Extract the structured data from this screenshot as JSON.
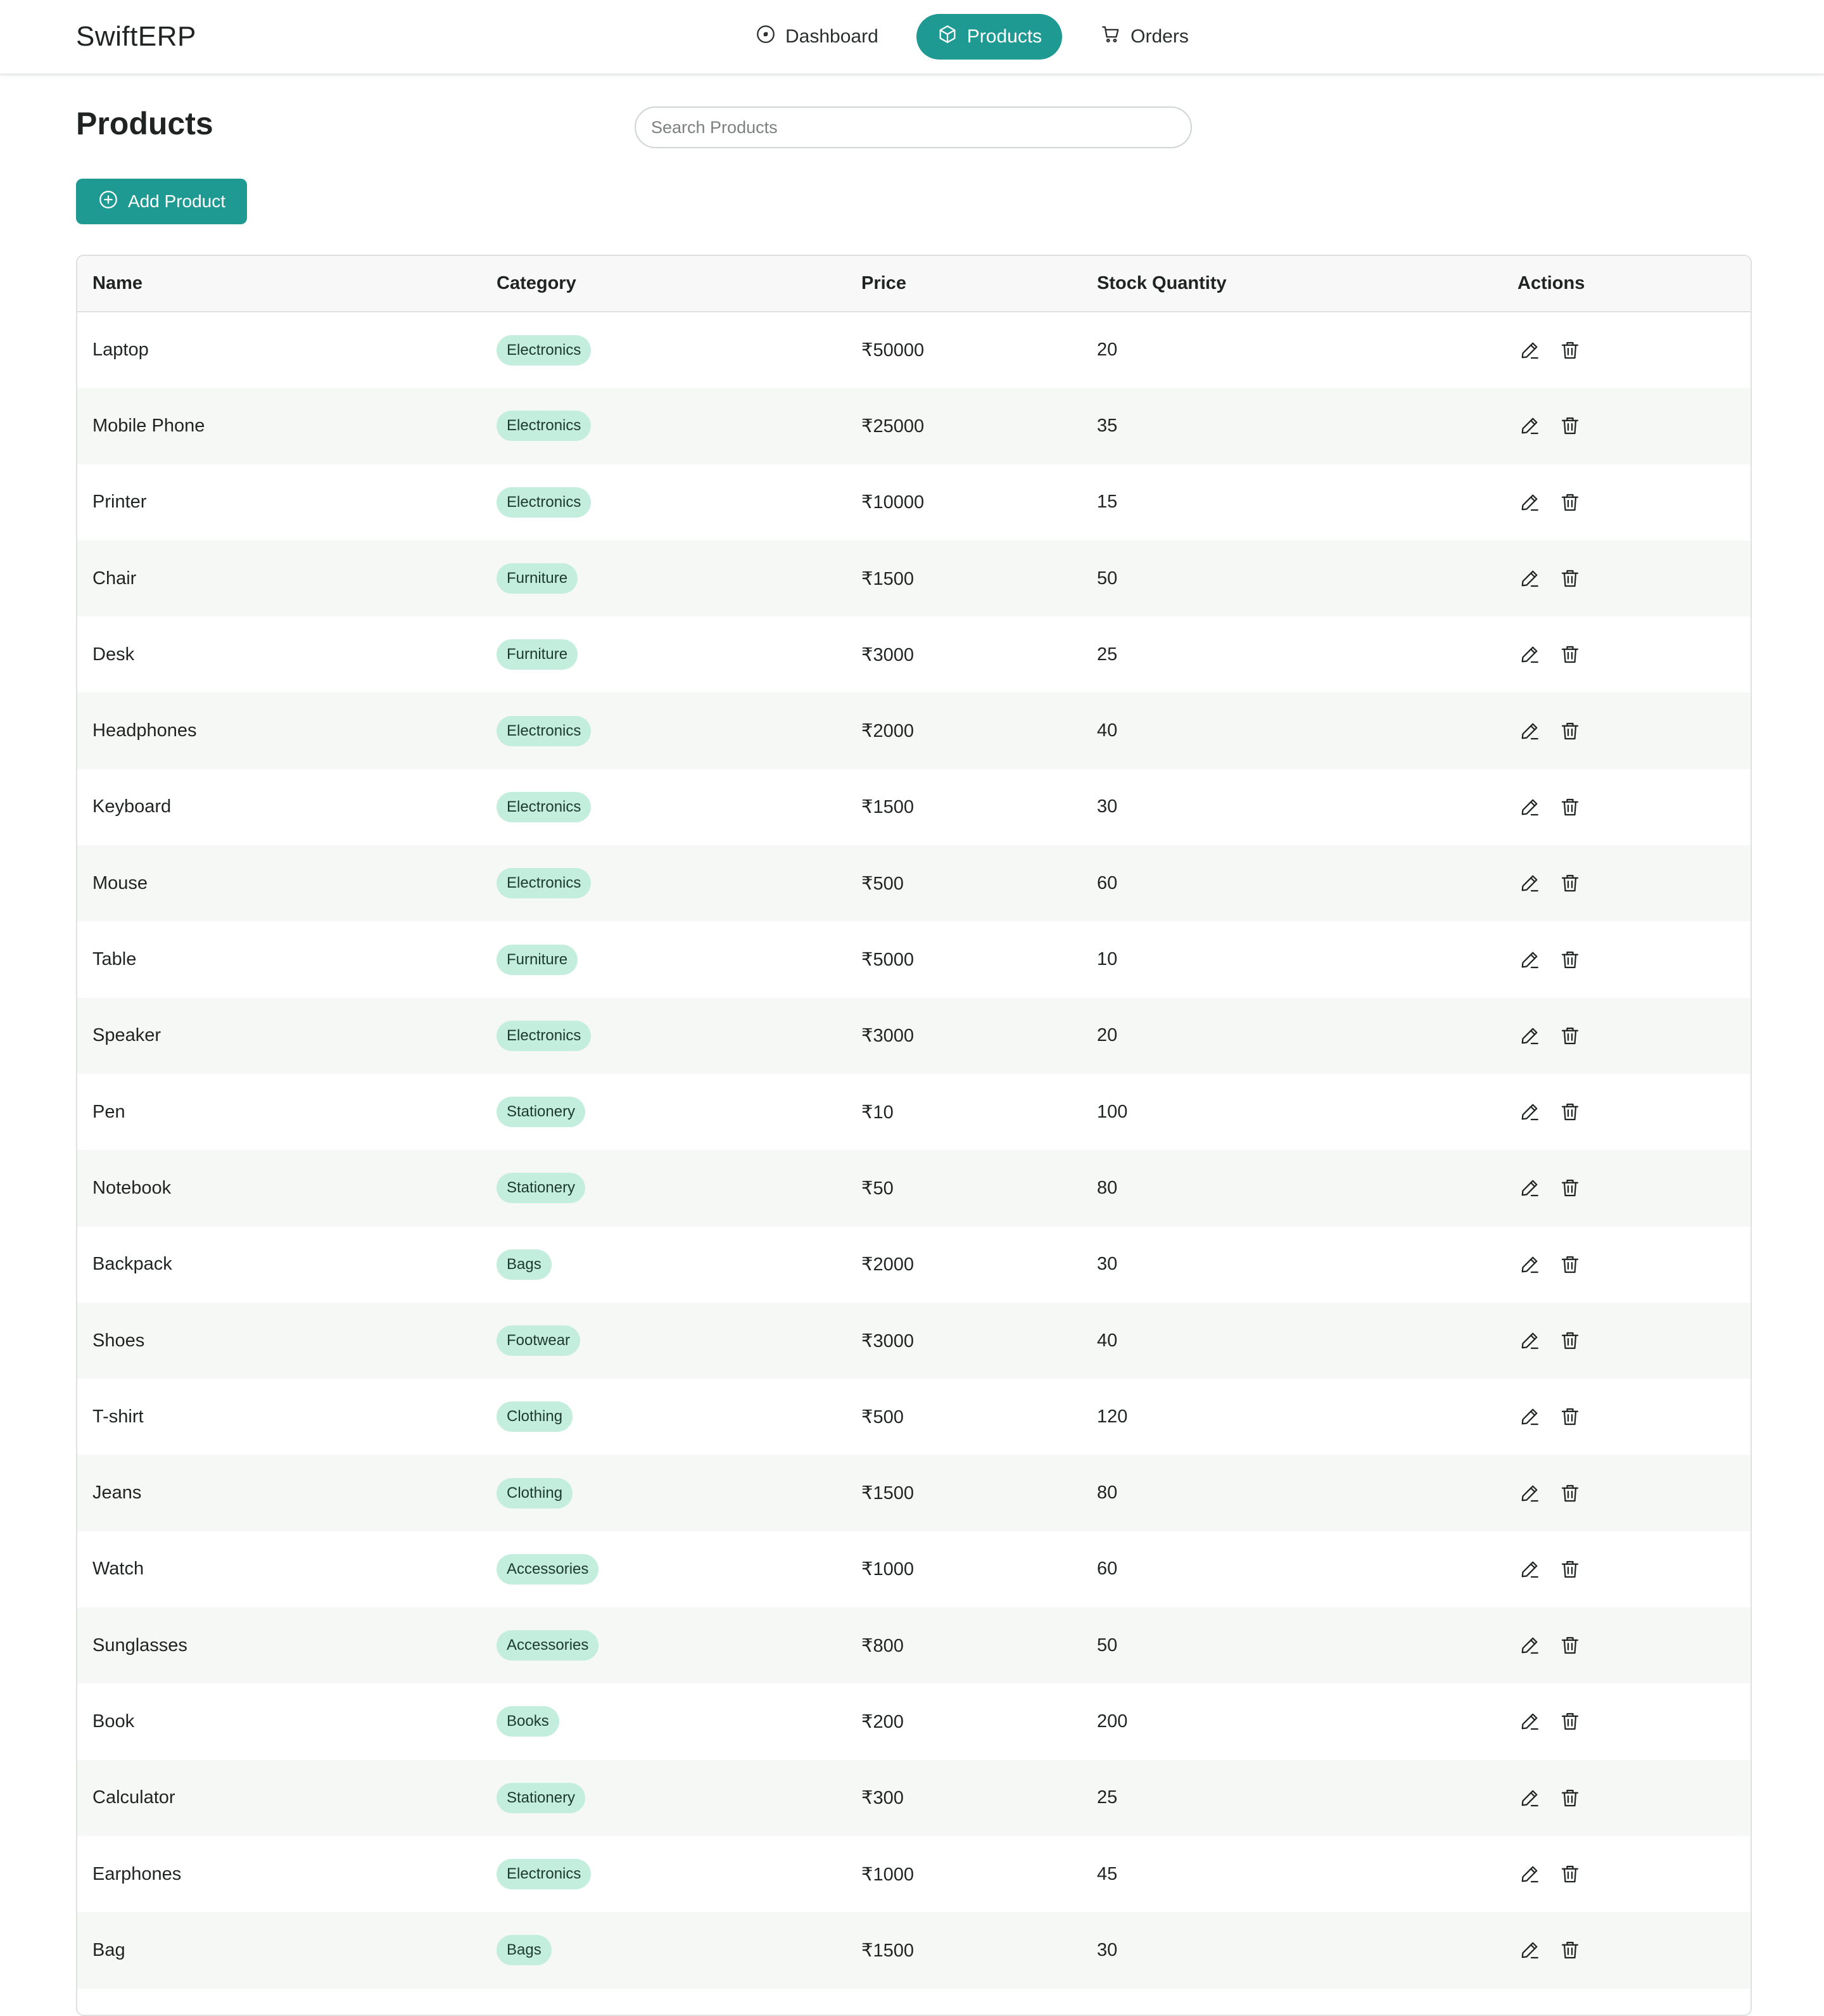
{
  "app": {
    "brand": "SwiftERP"
  },
  "nav": [
    {
      "label": "Dashboard",
      "icon": "gauge-icon",
      "active": false
    },
    {
      "label": "Products",
      "icon": "box-icon",
      "active": true
    },
    {
      "label": "Orders",
      "icon": "cart-icon",
      "active": false
    }
  ],
  "page": {
    "title": "Products"
  },
  "search": {
    "placeholder": "Search Products",
    "value": ""
  },
  "toolbar": {
    "add_label": "Add Product",
    "add_icon": "plus-circle-icon"
  },
  "colors": {
    "accent": "#1f9a93",
    "badge_bg": "#c3eedd",
    "row_alt": "#f6f8f6"
  },
  "table": {
    "columns": [
      "Name",
      "Category",
      "Price",
      "Stock Quantity",
      "Actions"
    ],
    "row_action_icons": [
      "edit-icon",
      "trash-icon"
    ],
    "rows": [
      {
        "name": "Laptop",
        "category": "Electronics",
        "price": "₹50000",
        "stock": "20"
      },
      {
        "name": "Mobile Phone",
        "category": "Electronics",
        "price": "₹25000",
        "stock": "35"
      },
      {
        "name": "Printer",
        "category": "Electronics",
        "price": "₹10000",
        "stock": "15"
      },
      {
        "name": "Chair",
        "category": "Furniture",
        "price": "₹1500",
        "stock": "50"
      },
      {
        "name": "Desk",
        "category": "Furniture",
        "price": "₹3000",
        "stock": "25"
      },
      {
        "name": "Headphones",
        "category": "Electronics",
        "price": "₹2000",
        "stock": "40"
      },
      {
        "name": "Keyboard",
        "category": "Electronics",
        "price": "₹1500",
        "stock": "30"
      },
      {
        "name": "Mouse",
        "category": "Electronics",
        "price": "₹500",
        "stock": "60"
      },
      {
        "name": "Table",
        "category": "Furniture",
        "price": "₹5000",
        "stock": "10"
      },
      {
        "name": "Speaker",
        "category": "Electronics",
        "price": "₹3000",
        "stock": "20"
      },
      {
        "name": "Pen",
        "category": "Stationery",
        "price": "₹10",
        "stock": "100"
      },
      {
        "name": "Notebook",
        "category": "Stationery",
        "price": "₹50",
        "stock": "80"
      },
      {
        "name": "Backpack",
        "category": "Bags",
        "price": "₹2000",
        "stock": "30"
      },
      {
        "name": "Shoes",
        "category": "Footwear",
        "price": "₹3000",
        "stock": "40"
      },
      {
        "name": "T-shirt",
        "category": "Clothing",
        "price": "₹500",
        "stock": "120"
      },
      {
        "name": "Jeans",
        "category": "Clothing",
        "price": "₹1500",
        "stock": "80"
      },
      {
        "name": "Watch",
        "category": "Accessories",
        "price": "₹1000",
        "stock": "60"
      },
      {
        "name": "Sunglasses",
        "category": "Accessories",
        "price": "₹800",
        "stock": "50"
      },
      {
        "name": "Book",
        "category": "Books",
        "price": "₹200",
        "stock": "200"
      },
      {
        "name": "Calculator",
        "category": "Stationery",
        "price": "₹300",
        "stock": "25"
      },
      {
        "name": "Earphones",
        "category": "Electronics",
        "price": "₹1000",
        "stock": "45"
      },
      {
        "name": "Bag",
        "category": "Bags",
        "price": "₹1500",
        "stock": "30"
      }
    ]
  }
}
